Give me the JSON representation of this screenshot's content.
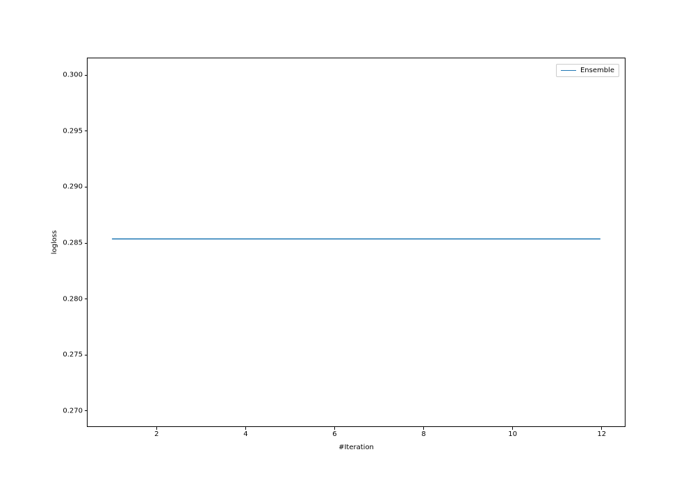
{
  "chart_data": {
    "type": "line",
    "series": [
      {
        "name": "Ensemble",
        "color": "#1f77b4",
        "x": [
          1,
          12
        ],
        "y": [
          0.2853,
          0.2853
        ]
      }
    ],
    "xlabel": "#Iteration",
    "ylabel": "logloss",
    "xlim": [
      0.45,
      12.55
    ],
    "ylim": [
      0.2685,
      0.3015
    ],
    "xticks": [
      2,
      4,
      6,
      8,
      10,
      12
    ],
    "yticks": [
      0.27,
      0.275,
      0.28,
      0.285,
      0.29,
      0.295,
      0.3
    ],
    "ytick_labels": [
      "0.270",
      "0.275",
      "0.280",
      "0.285",
      "0.290",
      "0.295",
      "0.300"
    ],
    "legend": [
      "Ensemble"
    ]
  }
}
